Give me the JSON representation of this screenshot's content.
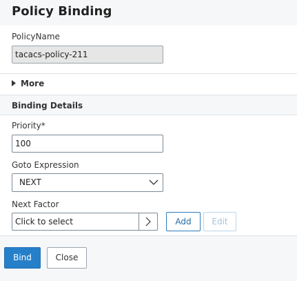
{
  "dialog": {
    "title": "Policy Binding"
  },
  "policy_name": {
    "label": "PolicyName",
    "value": "tacacs-policy-211"
  },
  "more": {
    "label": "More"
  },
  "binding_details": {
    "section_title": "Binding Details",
    "priority": {
      "label": "Priority*",
      "value": "100"
    },
    "goto_expression": {
      "label": "Goto Expression",
      "selected": "NEXT"
    },
    "next_factor": {
      "label": "Next Factor",
      "placeholder": "Click to select"
    },
    "add_label": "Add",
    "edit_label": "Edit"
  },
  "footer": {
    "bind_label": "Bind",
    "close_label": "Close"
  },
  "colors": {
    "primary": "#2680c9",
    "header_bg": "#f5f7f9",
    "border": "#7d8a96"
  }
}
